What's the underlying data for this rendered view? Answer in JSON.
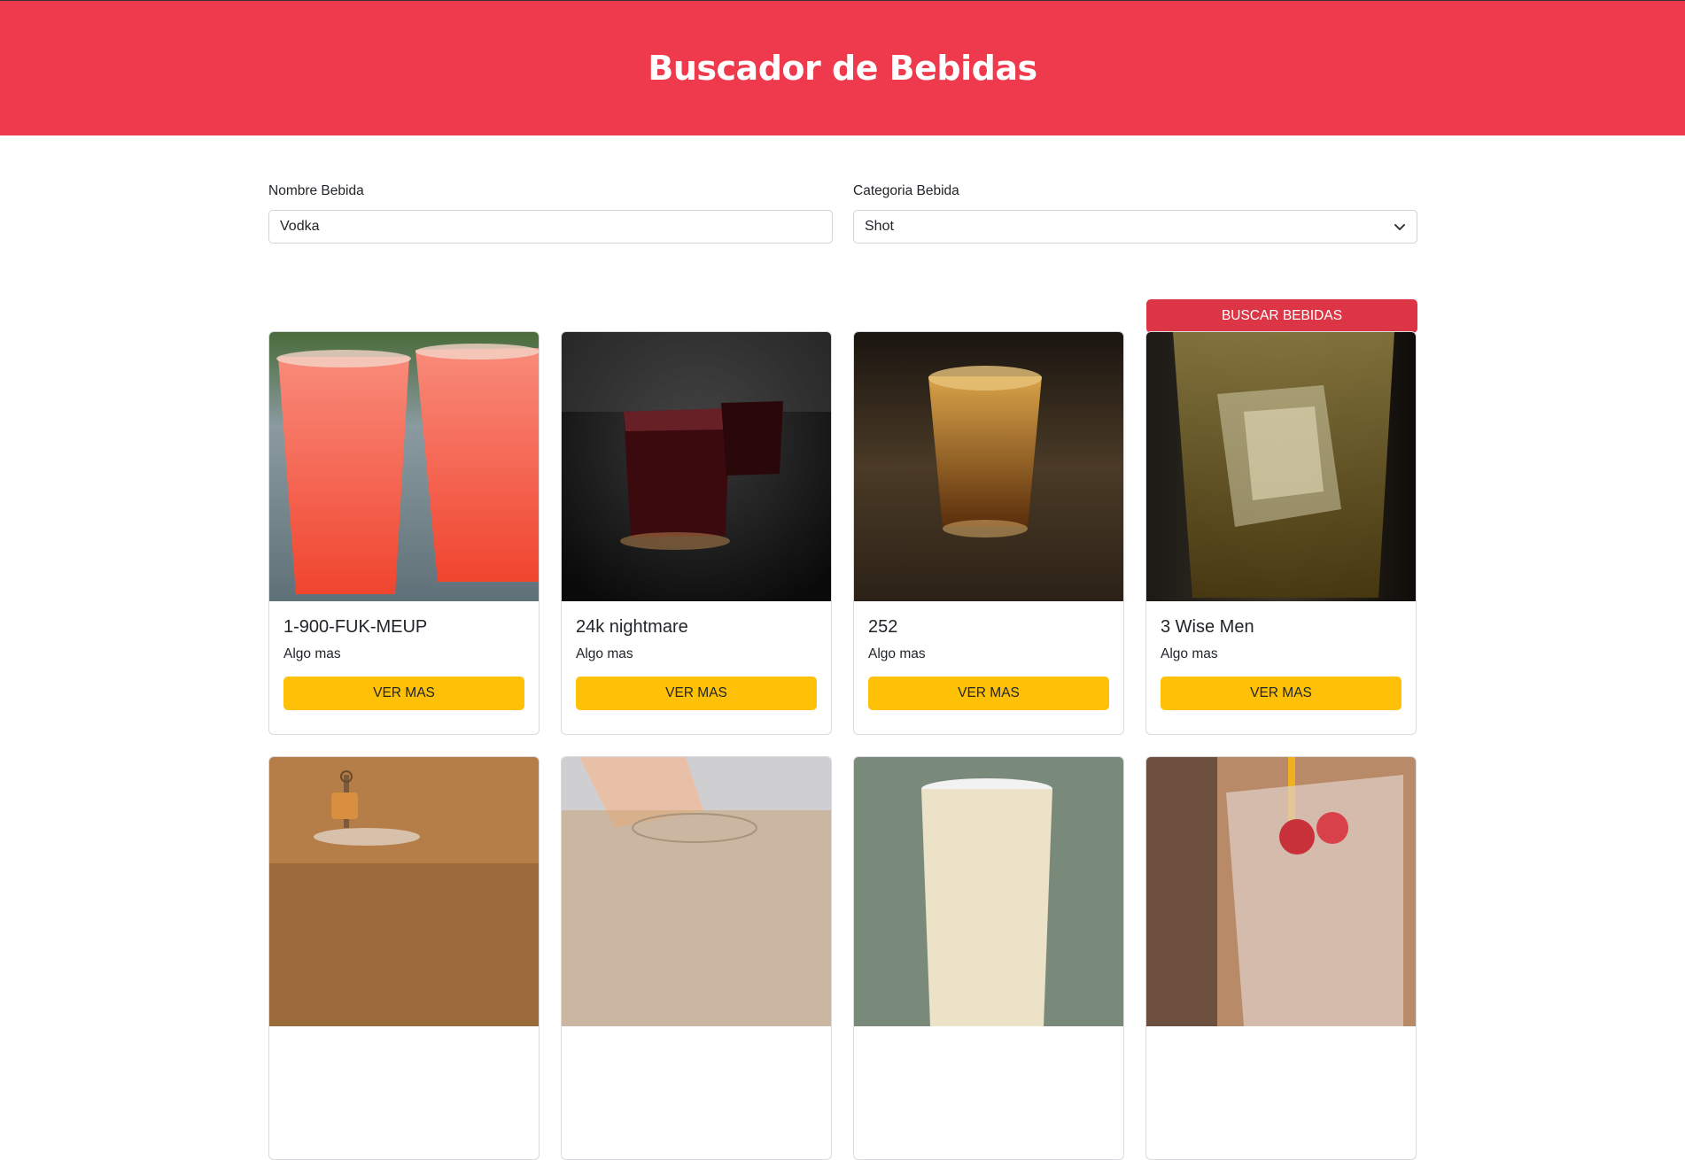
{
  "header": {
    "title": "Buscador de Bebidas"
  },
  "form": {
    "name_label": "Nombre Bebida",
    "name_value": "Vodka",
    "category_label": "Categoria Bebida",
    "category_value": "Shot",
    "search_button": "BUSCAR BEBIDAS"
  },
  "drinks": [
    {
      "name": "1-900-FUK-MEUP",
      "desc": "Algo mas",
      "button": "VER MAS"
    },
    {
      "name": "24k nightmare",
      "desc": "Algo mas",
      "button": "VER MAS"
    },
    {
      "name": "252",
      "desc": "Algo mas",
      "button": "VER MAS"
    },
    {
      "name": "3 Wise Men",
      "desc": "Algo mas",
      "button": "VER MAS"
    }
  ],
  "colors": {
    "header_bg": "#ee3a4c",
    "search_button": "#dc3545",
    "more_button": "#ffc107"
  }
}
